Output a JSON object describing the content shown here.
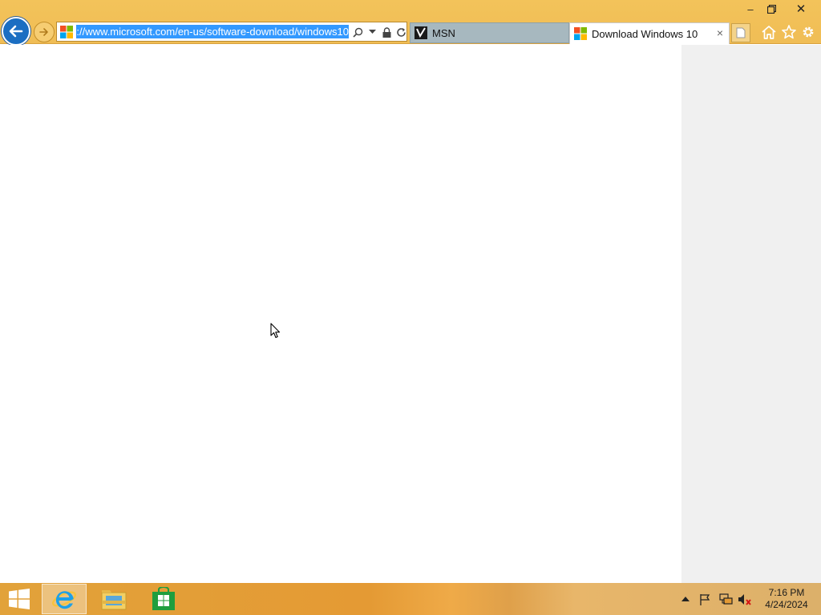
{
  "window": {
    "minimize_label": "–",
    "restore_label": "❐",
    "close_label": "✕"
  },
  "address_bar": {
    "url": "https://www.microsoft.com/en-us/software-download/windows10",
    "url_visible": "ps://www.microsoft.com/en-us/software-download/windows10",
    "icons": [
      "search-icon",
      "dropdown-icon",
      "lock-icon",
      "refresh-icon"
    ]
  },
  "tabs": [
    {
      "label": "MSN",
      "icon": "msn-icon",
      "active": false
    },
    {
      "label": "Download Windows 10",
      "icon": "windows-logo-icon",
      "active": true,
      "close_label": "×"
    }
  ],
  "toolbar": {
    "icons": [
      "home-icon",
      "favorites-star-icon",
      "settings-gear-icon"
    ]
  },
  "taskbar": {
    "items": [
      "internet-explorer-icon",
      "file-explorer-icon",
      "windows-store-icon"
    ],
    "tray_icons": [
      "show-hidden-icons-chevron",
      "action-center-flag-icon",
      "network-icon",
      "volume-muted-icon"
    ],
    "clock": {
      "time": "7:16 PM",
      "date": "4/24/2024"
    }
  },
  "colors": {
    "chrome": "#f0bd55",
    "accent_blue": "#1b6ec2",
    "selection": "#3399ff",
    "side_panel": "#f0f0f0"
  }
}
